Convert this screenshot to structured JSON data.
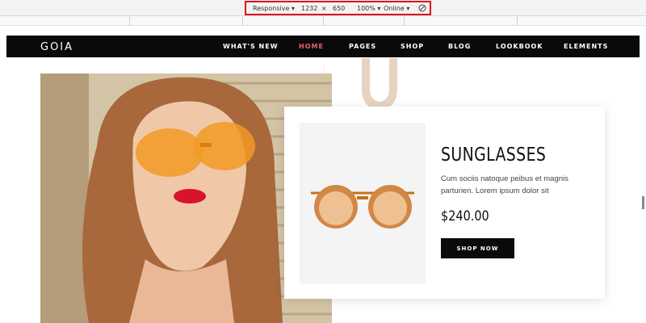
{
  "devtools": {
    "device": "Responsive",
    "width": "1232",
    "separator": "×",
    "height": "650",
    "zoom": "100%",
    "network": "Online"
  },
  "site": {
    "logo": "GOIA",
    "nav": [
      {
        "label": "WHAT'S NEW",
        "active": false
      },
      {
        "label": "HOME",
        "active": true
      },
      {
        "label": "PAGES",
        "active": false
      },
      {
        "label": "SHOP",
        "active": false
      },
      {
        "label": "BLOG",
        "active": false
      },
      {
        "label": "LOOKBOOK",
        "active": false
      },
      {
        "label": "ELEMENTS",
        "active": false
      }
    ],
    "accent_color": "#e8636b",
    "decor_color": "#e6d3c0"
  },
  "product": {
    "title": "SUNGLASSES",
    "description": "Cum sociis natoque peibus et magnis parturien. Lorem ipsum dolor sit",
    "price": "$240.00",
    "button": "SHOP NOW"
  }
}
